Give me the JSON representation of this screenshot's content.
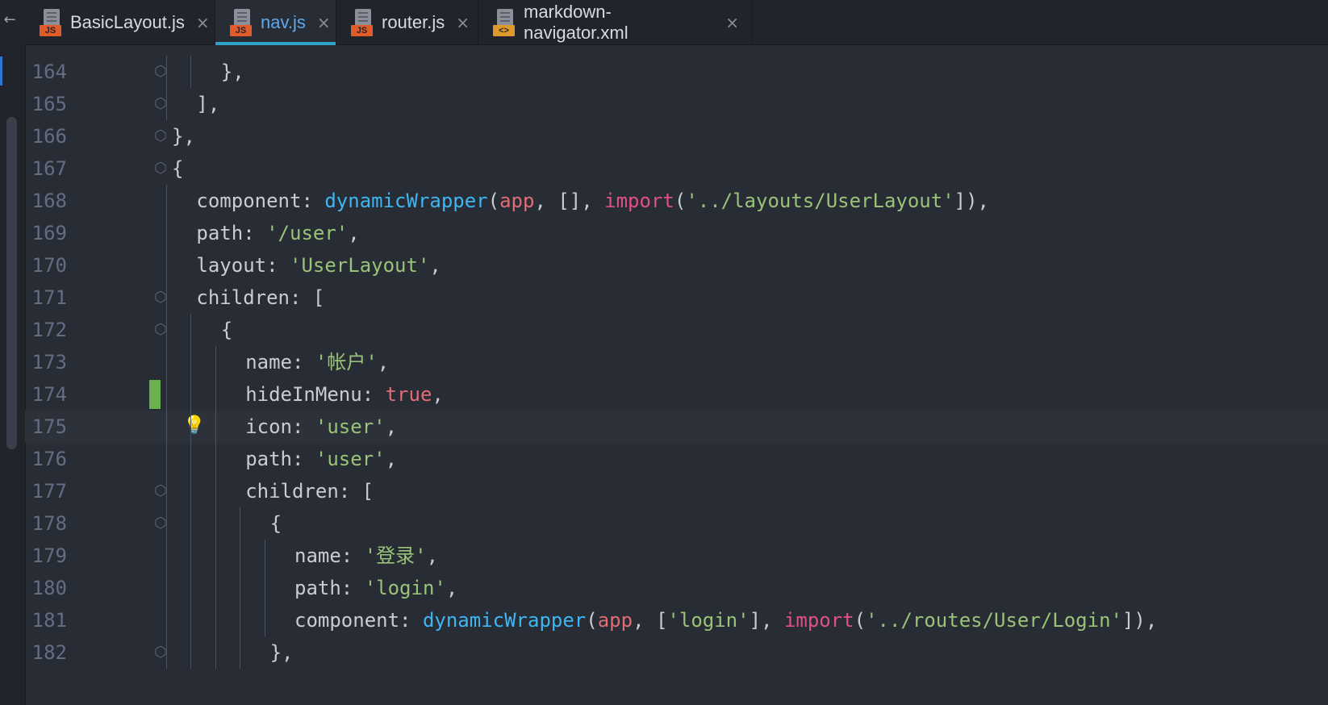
{
  "tabs": [
    {
      "name": "BasicLayout.js",
      "type_badge": "JS",
      "active": false
    },
    {
      "name": "nav.js",
      "type_badge": "JS",
      "active": true
    },
    {
      "name": "router.js",
      "type_badge": "JS",
      "active": false
    },
    {
      "name": "markdown-navigator.xml",
      "type_badge": "<>",
      "active": false
    }
  ],
  "current_line": 175,
  "lines": [
    {
      "n": 164,
      "indent": 4,
      "fold": true,
      "tokens": [
        [
          "punct",
          "},"
        ]
      ]
    },
    {
      "n": 165,
      "indent": 3,
      "fold": true,
      "tokens": [
        [
          "punct",
          "],"
        ]
      ]
    },
    {
      "n": 166,
      "indent": 2,
      "fold": true,
      "tokens": [
        [
          "punct",
          "},"
        ]
      ]
    },
    {
      "n": 167,
      "indent": 2,
      "fold": true,
      "tokens": [
        [
          "punct",
          "{"
        ]
      ]
    },
    {
      "n": 168,
      "indent": 3,
      "fold": false,
      "tokens": [
        [
          "key",
          "component"
        ],
        [
          "punct",
          ": "
        ],
        [
          "fn",
          "dynamicWrapper"
        ],
        [
          "punct",
          "("
        ],
        [
          "var",
          "app"
        ],
        [
          "punct",
          ", [], "
        ],
        [
          "kw",
          "import"
        ],
        [
          "punct",
          "("
        ],
        [
          "str",
          "'../layouts/UserLayout'"
        ],
        [
          "punct",
          "]),"
        ]
      ]
    },
    {
      "n": 169,
      "indent": 3,
      "fold": false,
      "tokens": [
        [
          "key",
          "path"
        ],
        [
          "punct",
          ": "
        ],
        [
          "str",
          "'/user'"
        ],
        [
          "punct",
          ","
        ]
      ]
    },
    {
      "n": 170,
      "indent": 3,
      "fold": false,
      "tokens": [
        [
          "key",
          "layout"
        ],
        [
          "punct",
          ": "
        ],
        [
          "str",
          "'UserLayout'"
        ],
        [
          "punct",
          ","
        ]
      ]
    },
    {
      "n": 171,
      "indent": 3,
      "fold": true,
      "tokens": [
        [
          "key",
          "children"
        ],
        [
          "punct",
          ": ["
        ]
      ]
    },
    {
      "n": 172,
      "indent": 4,
      "fold": true,
      "tokens": [
        [
          "punct",
          "{"
        ]
      ]
    },
    {
      "n": 173,
      "indent": 5,
      "fold": false,
      "tokens": [
        [
          "key",
          "name"
        ],
        [
          "punct",
          ": "
        ],
        [
          "str",
          "'帐户'"
        ],
        [
          "punct",
          ","
        ]
      ]
    },
    {
      "n": 174,
      "indent": 5,
      "fold": false,
      "changed": true,
      "tokens": [
        [
          "key",
          "hideInMenu"
        ],
        [
          "punct",
          ": "
        ],
        [
          "bool",
          "true"
        ],
        [
          "punct",
          ","
        ]
      ]
    },
    {
      "n": 175,
      "indent": 5,
      "fold": false,
      "bulb": true,
      "tokens": [
        [
          "key",
          "icon"
        ],
        [
          "punct",
          ": "
        ],
        [
          "str",
          "'user'"
        ],
        [
          "punct",
          ","
        ]
      ]
    },
    {
      "n": 176,
      "indent": 5,
      "fold": false,
      "tokens": [
        [
          "key",
          "path"
        ],
        [
          "punct",
          ": "
        ],
        [
          "str",
          "'user'"
        ],
        [
          "punct",
          ","
        ]
      ]
    },
    {
      "n": 177,
      "indent": 5,
      "fold": true,
      "tokens": [
        [
          "key",
          "children"
        ],
        [
          "punct",
          ": ["
        ]
      ]
    },
    {
      "n": 178,
      "indent": 6,
      "fold": true,
      "tokens": [
        [
          "punct",
          "{"
        ]
      ]
    },
    {
      "n": 179,
      "indent": 7,
      "fold": false,
      "tokens": [
        [
          "key",
          "name"
        ],
        [
          "punct",
          ": "
        ],
        [
          "str",
          "'登录'"
        ],
        [
          "punct",
          ","
        ]
      ]
    },
    {
      "n": 180,
      "indent": 7,
      "fold": false,
      "tokens": [
        [
          "key",
          "path"
        ],
        [
          "punct",
          ": "
        ],
        [
          "str",
          "'login'"
        ],
        [
          "punct",
          ","
        ]
      ]
    },
    {
      "n": 181,
      "indent": 7,
      "fold": false,
      "tokens": [
        [
          "key",
          "component"
        ],
        [
          "punct",
          ": "
        ],
        [
          "fn",
          "dynamicWrapper"
        ],
        [
          "punct",
          "("
        ],
        [
          "var",
          "app"
        ],
        [
          "punct",
          ", ["
        ],
        [
          "str",
          "'login'"
        ],
        [
          "punct",
          "], "
        ],
        [
          "kw",
          "import"
        ],
        [
          "punct",
          "("
        ],
        [
          "str",
          "'../routes/User/Login'"
        ],
        [
          "punct",
          "]),"
        ]
      ]
    },
    {
      "n": 182,
      "indent": 6,
      "fold": true,
      "tokens": [
        [
          "punct",
          "},"
        ]
      ]
    }
  ]
}
